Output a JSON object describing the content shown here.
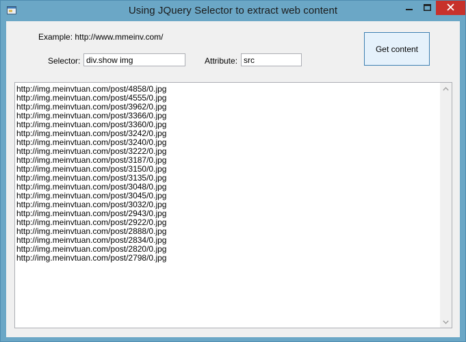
{
  "window": {
    "title": "Using JQuery Selector to extract web content"
  },
  "form": {
    "example_text": "Example: http://www.mmeinv.com/",
    "selector_label": "Selector:",
    "selector_value": "div.show img",
    "attribute_label": "Attribute:",
    "attribute_value": "src",
    "get_button_label": "Get content"
  },
  "results": [
    "http://img.meinvtuan.com/post/4858/0.jpg",
    "http://img.meinvtuan.com/post/4555/0.jpg",
    "http://img.meinvtuan.com/post/3962/0.jpg",
    "http://img.meinvtuan.com/post/3366/0.jpg",
    "http://img.meinvtuan.com/post/3360/0.jpg",
    "http://img.meinvtuan.com/post/3242/0.jpg",
    "http://img.meinvtuan.com/post/3240/0.jpg",
    "http://img.meinvtuan.com/post/3222/0.jpg",
    "http://img.meinvtuan.com/post/3187/0.jpg",
    "http://img.meinvtuan.com/post/3150/0.jpg",
    "http://img.meinvtuan.com/post/3135/0.jpg",
    "http://img.meinvtuan.com/post/3048/0.jpg",
    "http://img.meinvtuan.com/post/3045/0.jpg",
    "http://img.meinvtuan.com/post/3032/0.jpg",
    "http://img.meinvtuan.com/post/2943/0.jpg",
    "http://img.meinvtuan.com/post/2922/0.jpg",
    "http://img.meinvtuan.com/post/2888/0.jpg",
    "http://img.meinvtuan.com/post/2834/0.jpg",
    "http://img.meinvtuan.com/post/2820/0.jpg",
    "http://img.meinvtuan.com/post/2798/0.jpg"
  ],
  "icons": {
    "app": "app-window-icon",
    "minimize": "minimize-icon",
    "maximize": "maximize-icon",
    "close": "close-icon",
    "scroll_up": "chevron-up-icon",
    "scroll_down": "chevron-down-icon"
  },
  "colors": {
    "window_frame": "#6ba7c6",
    "close_button": "#c7312b",
    "client_background": "#f0f0f0",
    "button_border": "#3c7fb1"
  }
}
